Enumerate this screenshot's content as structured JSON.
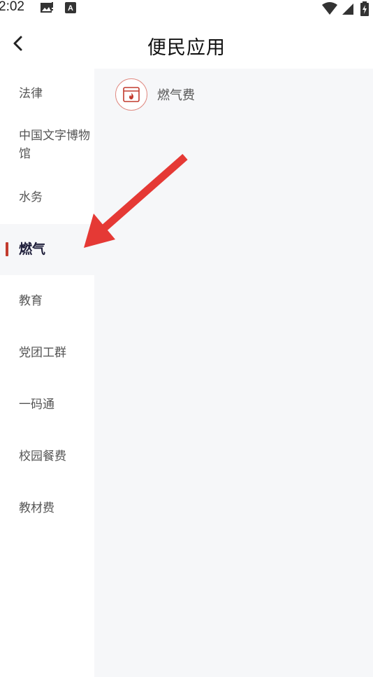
{
  "status_bar": {
    "time": "2:02",
    "icons": [
      "gallery-icon",
      "text-recognition-icon",
      "wifi-icon",
      "signal-icon",
      "battery-charging-icon"
    ]
  },
  "header": {
    "title": "便民应用",
    "back_icon": "chevron-left-icon"
  },
  "sidebar": {
    "items": [
      {
        "label": "法律",
        "active": false
      },
      {
        "label": "中国文字博物馆",
        "active": false
      },
      {
        "label": "水务",
        "active": false
      },
      {
        "label": "燃气",
        "active": true
      },
      {
        "label": "教育",
        "active": false
      },
      {
        "label": "党团工群",
        "active": false
      },
      {
        "label": "一码通",
        "active": false
      },
      {
        "label": "校园餐费",
        "active": false
      },
      {
        "label": "教材费",
        "active": false
      }
    ],
    "active_color": "#c23b2e"
  },
  "main": {
    "apps": [
      {
        "label": "燃气费",
        "icon": "gas-flame-bill-icon"
      }
    ]
  },
  "annotation": {
    "arrow_color": "#e53935"
  }
}
